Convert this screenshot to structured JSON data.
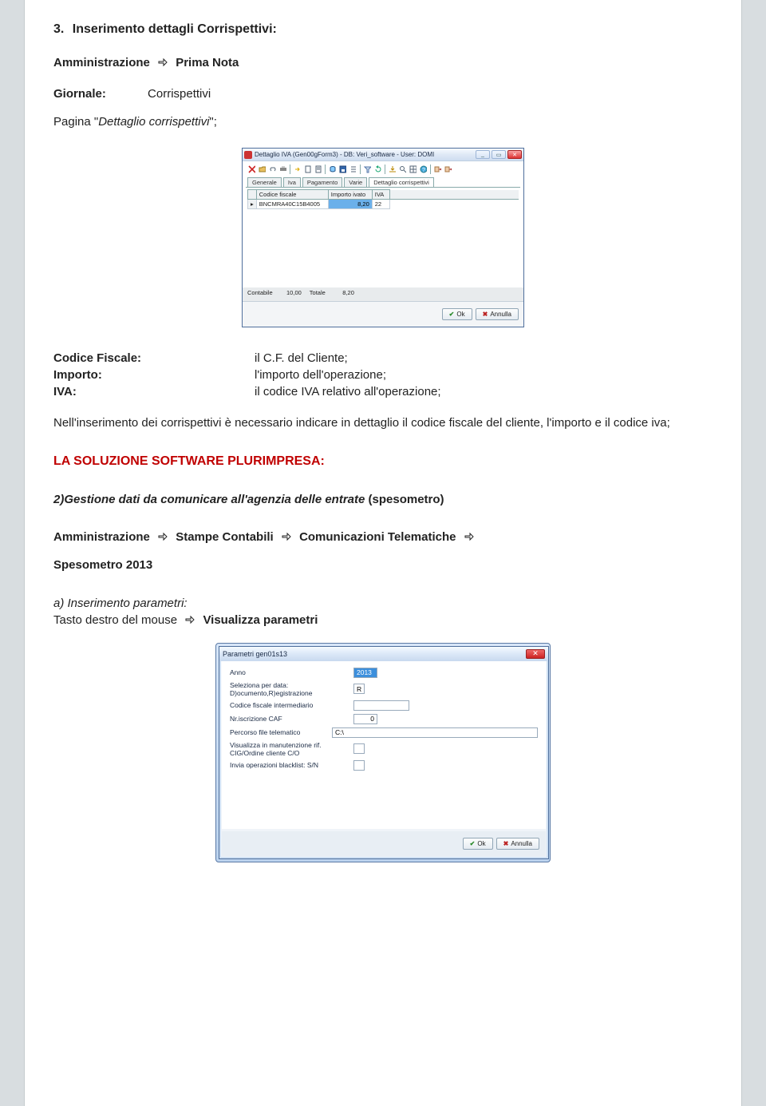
{
  "section": {
    "number": "3.",
    "title": "Inserimento dettagli Corrispettivi:",
    "breadcrumb1_a": "Amministrazione",
    "breadcrumb1_b": "Prima Nota",
    "giornale_label": "Giornale:",
    "giornale_value": "Corrispettivi",
    "pagina_prefix": "Pagina \"",
    "pagina_italic": "Dettaglio corrispettivi",
    "pagina_suffix": "\";"
  },
  "dlg1": {
    "title": "Dettaglio IVA  (Gen00gForm3) - DB: Veri_software - User: DOMI",
    "tabs": {
      "generale": "Generale",
      "iva": "Iva",
      "pagamento": "Pagamento",
      "varie": "Varie",
      "dettaglio": "Dettaglio corrispettivi"
    },
    "grid": {
      "headers": {
        "cf": "Codice fiscale",
        "importo": "Importo ivato",
        "iva": "IVA"
      },
      "row1": {
        "cf": "BNCMRA40C15B4005",
        "importo": "8,20",
        "iva": "22"
      }
    },
    "footer": {
      "contabile_label": "Contabile",
      "contabile_value": "10,00",
      "totale_label": "Totale",
      "totale_value": "8,20"
    },
    "buttons": {
      "ok": "Ok",
      "annulla": "Annulla"
    }
  },
  "defs": {
    "cf_label": "Codice Fiscale:",
    "cf_value": "il C.F. del Cliente;",
    "importo_label": "Importo:",
    "importo_value": "l'importo dell'operazione;",
    "iva_label": "IVA:",
    "iva_value": "il codice IVA relativo all'operazione;"
  },
  "para1": "Nell'inserimento dei corrispettivi è necessario indicare in dettaglio il codice fiscale  del cliente, l'importo e il codice iva;",
  "solution_title": "LA SOLUZIONE SOFTWARE PLURIMPRESA:",
  "subtitle2_pre": "2)Gestione dati da comunicare all'agenzia delle entrate",
  "subtitle2_paren": " (spesometro)",
  "breadcrumb2": {
    "a": "Amministrazione",
    "b": "Stampe Contabili",
    "c": "Comunicazioni Telematiche",
    "d": "Spesometro 2013"
  },
  "step_a": "a)  Inserimento parametri:",
  "step_a2_pre": "Tasto destro del mouse ",
  "step_a2_bold": "Visualizza parametri",
  "dlg2": {
    "title": "Parametri gen01s13",
    "fields": {
      "anno_label": "Anno",
      "anno_value": "2013",
      "sel_label": "Seleziona per data: D)ocumento,R)egistrazione",
      "sel_value": "R",
      "cf_label": "Codice fiscale intermediario",
      "cf_value": "",
      "nr_caf_label": "Nr.iscrizione CAF",
      "nr_caf_value": "0",
      "path_label": "Percorso file telematico",
      "path_value": "C:\\",
      "vis_label": "Visualizza in manutenzione rif. CIG/Ordine cliente  C/O",
      "vis_value": "",
      "bl_label": "Invia operazioni blacklist: S/N",
      "bl_value": ""
    },
    "buttons": {
      "ok": "Ok",
      "annulla": "Annulla"
    }
  }
}
